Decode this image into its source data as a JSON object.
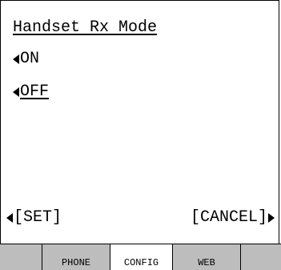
{
  "screen": {
    "title": "Handset Rx Mode",
    "options": [
      {
        "label": "ON",
        "selected": false
      },
      {
        "label": "OFF",
        "selected": true
      }
    ],
    "softkeys": {
      "left": "[SET]",
      "right": "[CANCEL]"
    }
  },
  "tabs": [
    {
      "label": ""
    },
    {
      "label": "PHONE"
    },
    {
      "label": "CONFIG",
      "active": true
    },
    {
      "label": "WEB"
    },
    {
      "label": ""
    }
  ],
  "colors": {
    "tab_inactive": "#bdbdbd",
    "tab_active": "#ffffff",
    "text": "#000000"
  }
}
